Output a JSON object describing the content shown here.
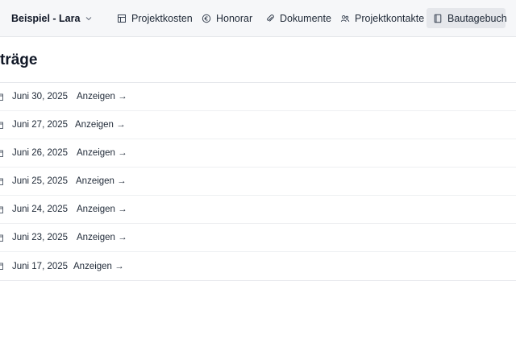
{
  "header": {
    "project_label": "Beispiel - Lara",
    "nav": [
      {
        "label": "Projektkosten",
        "icon": "grid-icon"
      },
      {
        "label": "Honorar",
        "icon": "euro-circle-icon"
      },
      {
        "label": "Dokumente",
        "icon": "paperclip-icon"
      },
      {
        "label": "Projektkontakte",
        "icon": "users-icon"
      },
      {
        "label": "Bautagebuch",
        "icon": "book-icon",
        "active": true
      }
    ]
  },
  "main": {
    "title": "träge",
    "entries": [
      {
        "date": "Juni 30, 2025",
        "link": "Anzeigen →"
      },
      {
        "date": "Juni 27, 2025",
        "link": "Anzeigen →"
      },
      {
        "date": "Juni 26, 2025",
        "link": "Anzeigen →"
      },
      {
        "date": "Juni 25, 2025",
        "link": "Anzeigen →"
      },
      {
        "date": "Juni 24, 2025",
        "link": "Anzeigen →"
      },
      {
        "date": "Juni 23, 2025",
        "link": "Anzeigen →"
      },
      {
        "date": "Juni 17, 2025",
        "link": "Anzeigen →"
      }
    ]
  }
}
